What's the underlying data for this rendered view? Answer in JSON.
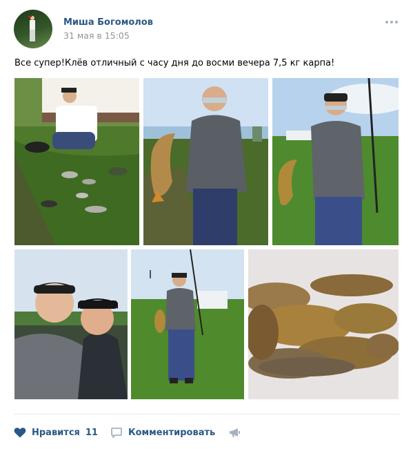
{
  "author": {
    "name": "Миша Богомолов",
    "date": "31 мая в 15:05"
  },
  "post": {
    "text": "Все супер!Клёв отличный с часу дня до восми вечера 7,5 кг карпа!"
  },
  "actions": {
    "like_label": "Нравится",
    "like_count": "11",
    "comment_label": "Комментировать"
  },
  "icons": {
    "more": "more-dots-icon",
    "like": "heart-icon",
    "comment": "comment-icon",
    "share": "megaphone-share-icon"
  },
  "colors": {
    "link": "#2a5885",
    "muted": "#939393",
    "icon": "#a6b2c1"
  }
}
